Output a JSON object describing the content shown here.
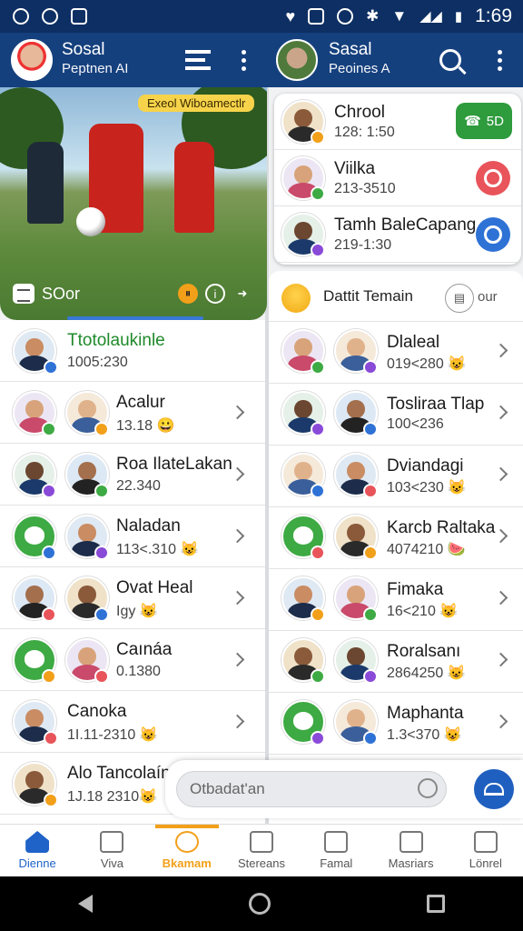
{
  "status": {
    "time": "1:69"
  },
  "left_header": {
    "title": "Sosal",
    "subtitle": "Peptnen AI"
  },
  "right_header": {
    "title": "Sasal",
    "subtitle": "Peoines A"
  },
  "hero": {
    "tag": "Exeol Wiboamectlr",
    "caption": "SOor"
  },
  "featured": [
    {
      "name": "Chrool",
      "sub": "128: 1:50",
      "action": "5D",
      "action_color": "#2e9b3d"
    },
    {
      "name": "Viilka",
      "sub": "213-3510",
      "action_color": "#e8545a"
    },
    {
      "name": "Tamh BaleCapang",
      "sub": "219-1:30",
      "action_color": "#2f72d6"
    }
  ],
  "right_section": {
    "title": "Dattit Temain",
    "more": "our"
  },
  "left_list": [
    {
      "name": "Ttotolaukinle",
      "sub": "1005:230",
      "highlight": true
    },
    {
      "name": "Acalur",
      "sub": "13.18 😀"
    },
    {
      "name": "Roa IlateLakan",
      "sub": "22.340"
    },
    {
      "name": "Naladan",
      "sub": "113<.310 😺"
    },
    {
      "name": "Ovat Heal",
      "sub": "Igy 😺"
    },
    {
      "name": "Caınáa",
      "sub": "0.1380"
    },
    {
      "name": "Canoka",
      "sub": "1I.11-2310 😺"
    },
    {
      "name": "Alo Tancolaín",
      "sub": "1J.18 2310😺"
    }
  ],
  "right_list": [
    {
      "name": "Dlaleal",
      "sub": "019<280 😺"
    },
    {
      "name": "Tosliraa Tlap",
      "sub": "100<236"
    },
    {
      "name": "Dviandagi",
      "sub": "103<230 😺"
    },
    {
      "name": "Karcb Raltaka",
      "sub": "4074210 🍉"
    },
    {
      "name": "Fimaka",
      "sub": "16<210 😺"
    },
    {
      "name": "Roralsanı",
      "sub": "2864250 😺"
    },
    {
      "name": "Maphanta",
      "sub": "1.3<370 😺"
    }
  ],
  "search": {
    "placeholder": "Otbadat'an"
  },
  "bottom_nav": [
    {
      "label": "Dienne"
    },
    {
      "label": "Viva"
    },
    {
      "label": "Bkamam"
    },
    {
      "label": "Sterеans"
    },
    {
      "label": "Famal"
    },
    {
      "label": "Masriars"
    },
    {
      "label": "Lönrel"
    }
  ],
  "colors": {
    "brand": "#15407e",
    "accent": "#f2a01a",
    "green": "#3daa43"
  }
}
